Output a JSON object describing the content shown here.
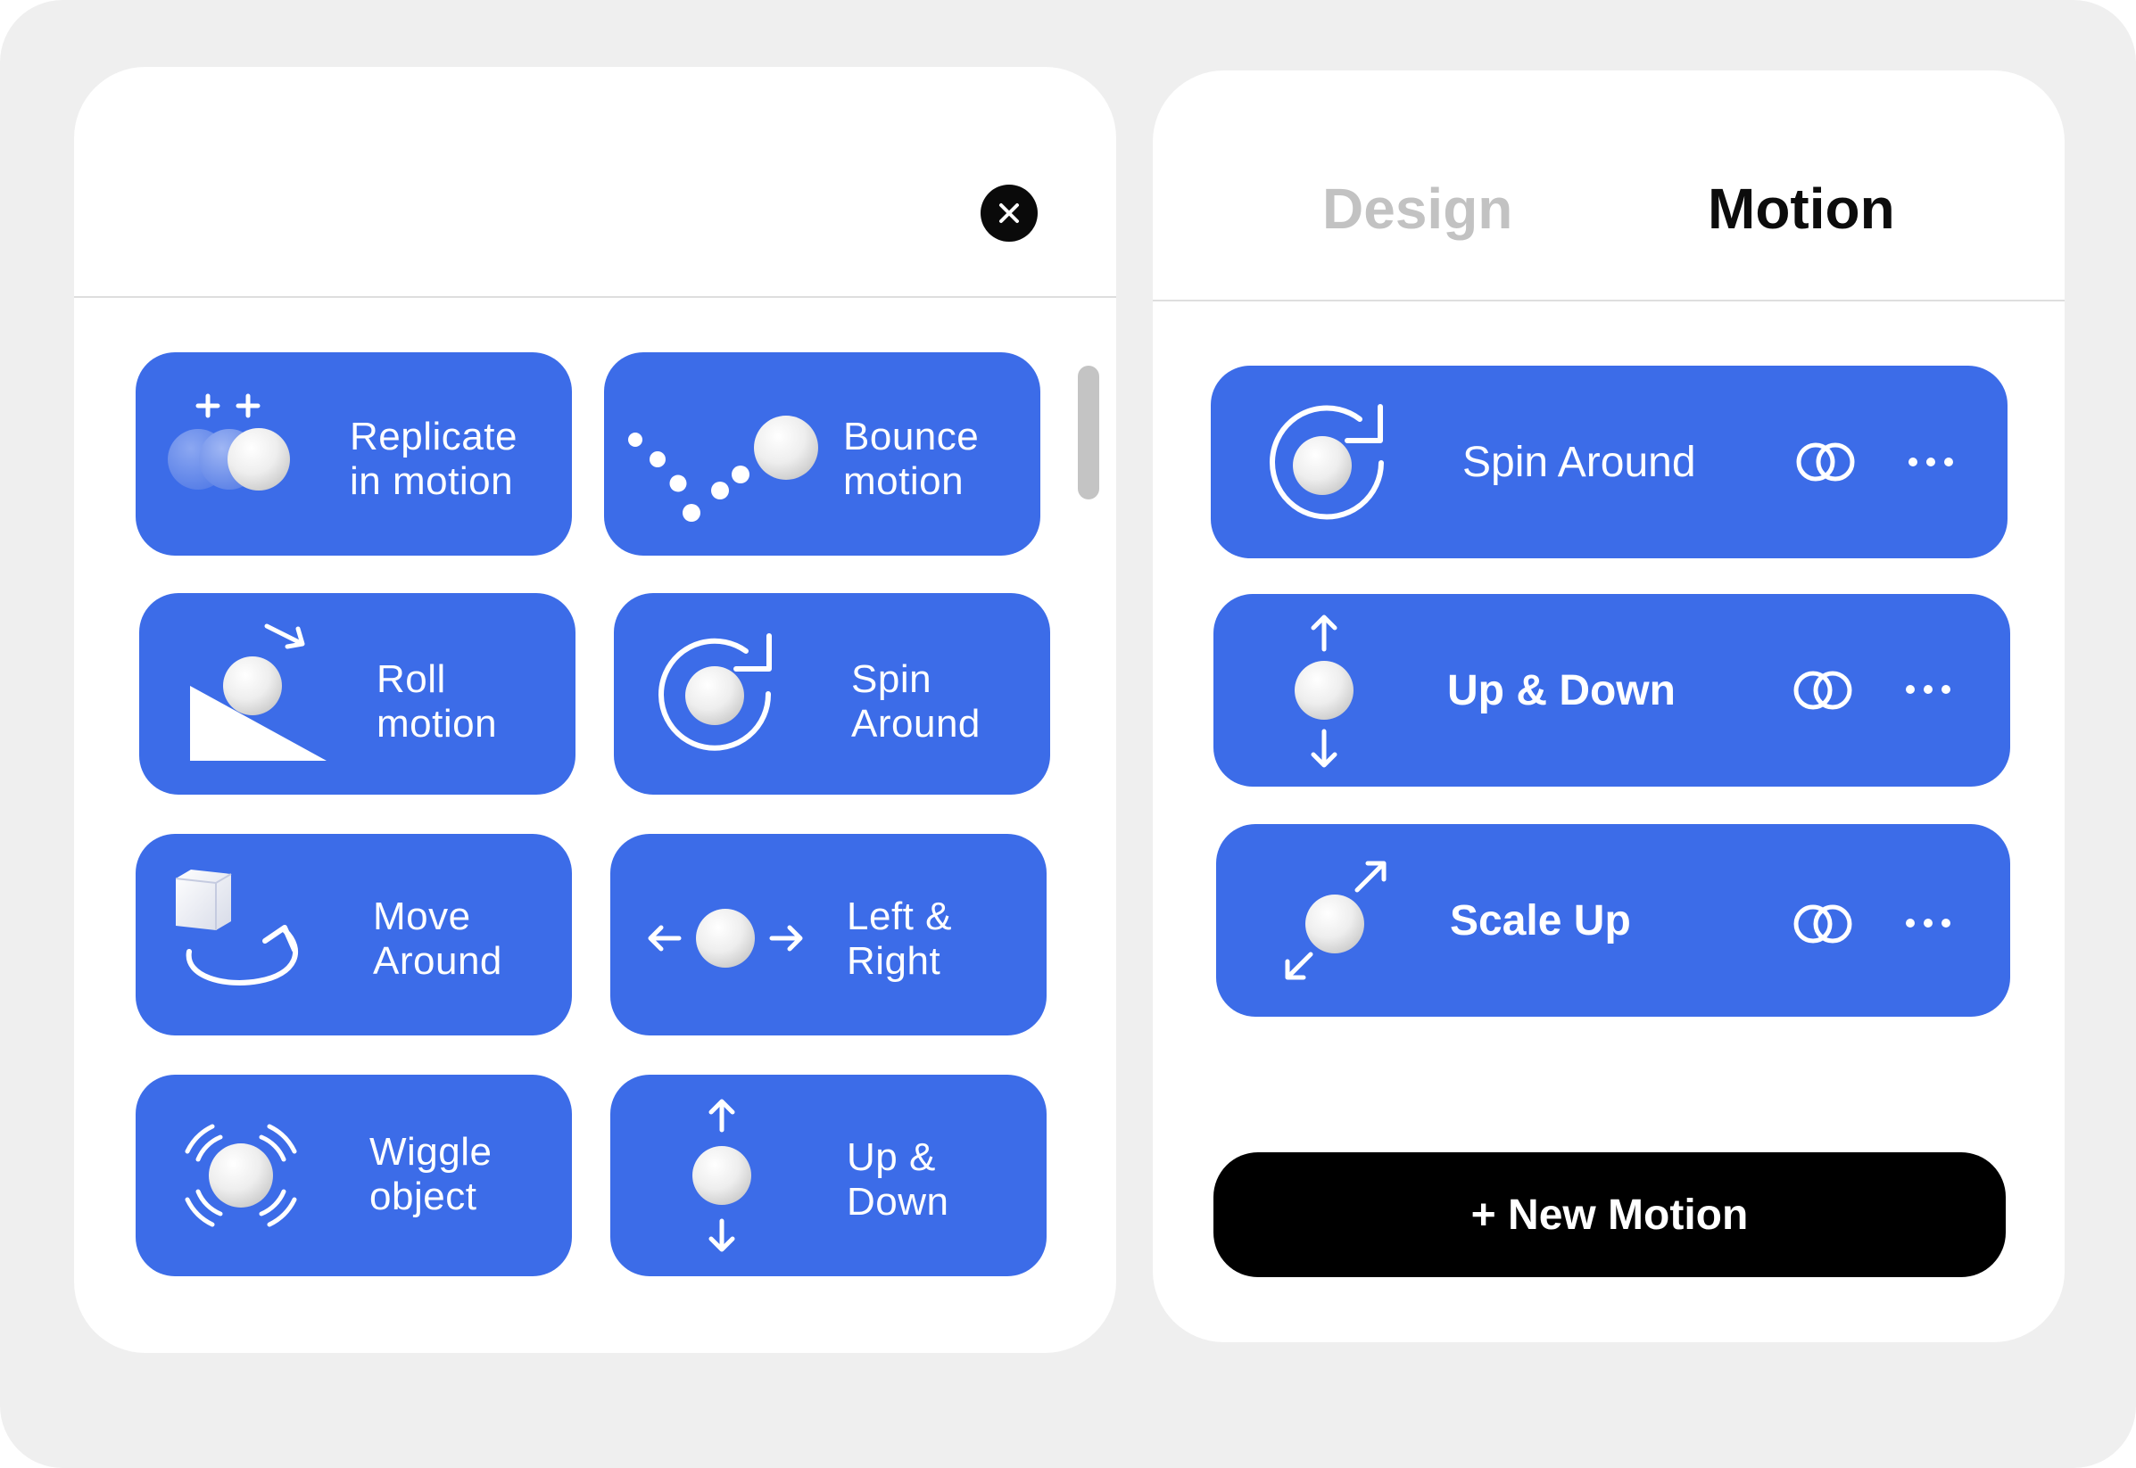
{
  "colors": {
    "accent": "#3c6ce8",
    "background": "#efefef",
    "panel": "#ffffff",
    "tab_inactive": "#c2c2c2",
    "tab_active": "#0c0c0c",
    "primary_button": "#000000"
  },
  "left_panel": {
    "close_icon": "close-icon",
    "presets": [
      {
        "id": "replicate",
        "label": "Replicate\nin motion",
        "icon": "replicate-icon"
      },
      {
        "id": "bounce",
        "label": "Bounce\nmotion",
        "icon": "bounce-icon"
      },
      {
        "id": "roll",
        "label": "Roll\nmotion",
        "icon": "roll-icon"
      },
      {
        "id": "spin",
        "label": "Spin\nAround",
        "icon": "spin-icon"
      },
      {
        "id": "move",
        "label": "Move\nAround",
        "icon": "move-around-icon"
      },
      {
        "id": "leftright",
        "label": "Left &\nRight",
        "icon": "left-right-icon"
      },
      {
        "id": "wiggle",
        "label": "Wiggle\nobject",
        "icon": "wiggle-icon"
      },
      {
        "id": "updown",
        "label": "Up &\nDown",
        "icon": "up-down-icon"
      }
    ]
  },
  "right_panel": {
    "tabs": [
      {
        "label": "Design",
        "active": false
      },
      {
        "label": "Motion",
        "active": true
      }
    ],
    "motions": [
      {
        "label": "Spin Around",
        "icon": "spin-icon",
        "blend_icon": "blend-icon",
        "more_icon": "more-icon"
      },
      {
        "label": "Up & Down",
        "icon": "up-down-icon",
        "blend_icon": "blend-icon",
        "more_icon": "more-icon"
      },
      {
        "label": "Scale Up",
        "icon": "scale-up-icon",
        "blend_icon": "blend-icon",
        "more_icon": "more-icon"
      }
    ],
    "new_motion_label": "+ New Motion"
  }
}
